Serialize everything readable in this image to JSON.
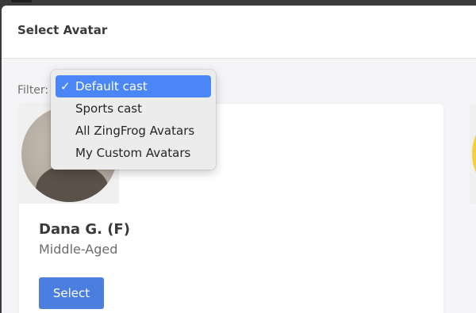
{
  "modal": {
    "title": "Select Avatar"
  },
  "filter": {
    "label": "Filter:",
    "options": [
      {
        "label": "Default cast",
        "selected": true
      },
      {
        "label": "Sports cast",
        "selected": false
      },
      {
        "label": "All ZingFrog Avatars",
        "selected": false
      },
      {
        "label": "My Custom Avatars",
        "selected": false
      }
    ],
    "check_mark": "✓"
  },
  "avatar_card": {
    "name": "Dana G. (F)",
    "age_group": "Middle-Aged",
    "select_label": "Select"
  },
  "colors": {
    "accent": "#4c7ee0",
    "menu_highlight": "#4b86f7",
    "next_card_avatar": "#f3d13a"
  }
}
